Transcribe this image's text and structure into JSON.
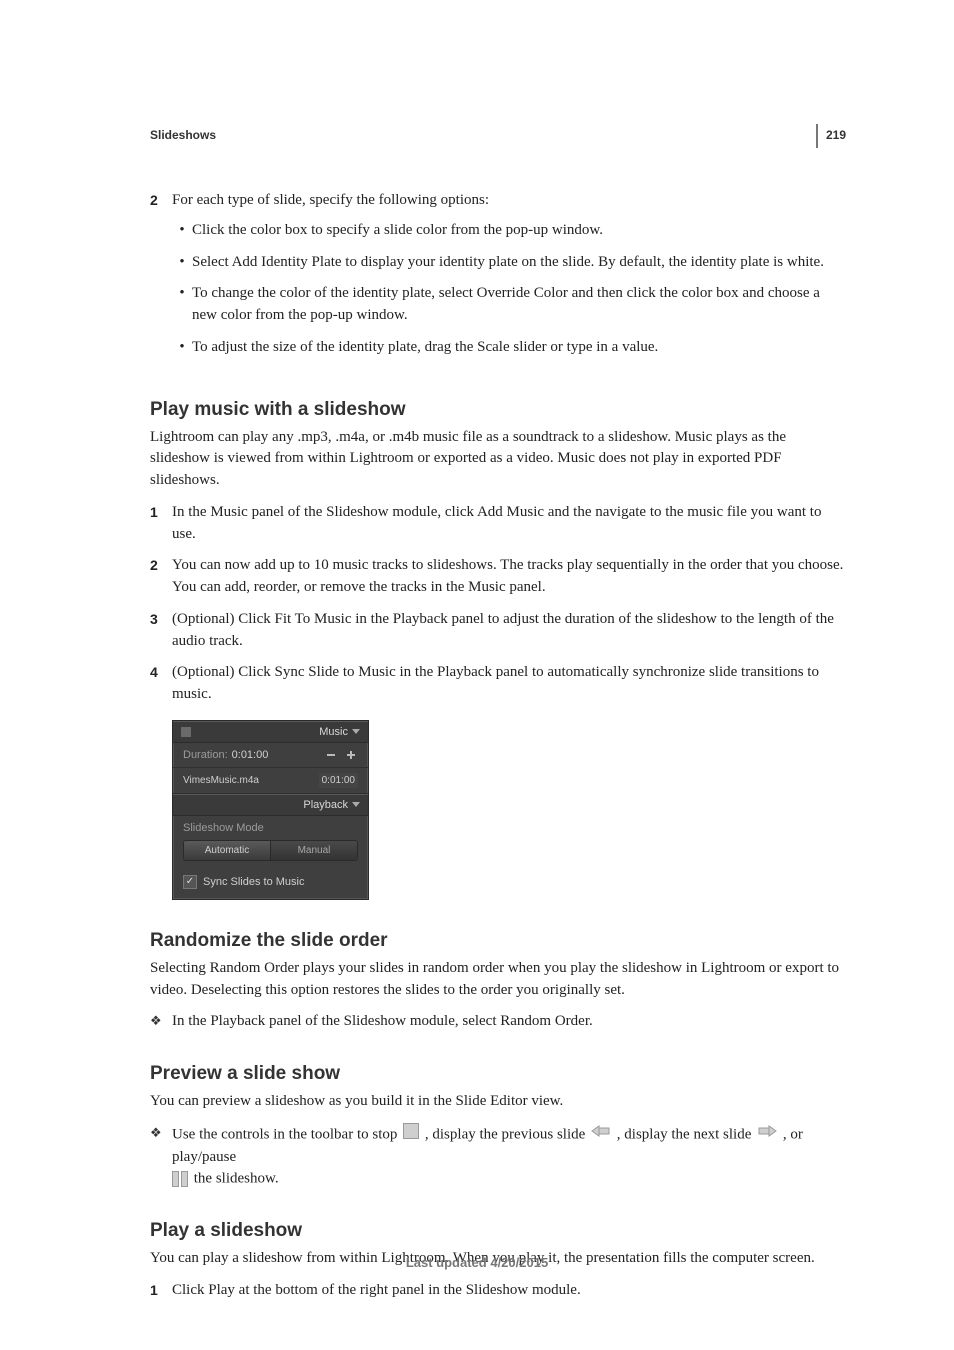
{
  "page_number": "219",
  "section_header": "Slideshows",
  "step2": {
    "num": "2",
    "lead": "For each type of slide, specify the following options:",
    "bullets": [
      "Click the color box to specify a slide color from the pop-up window.",
      "Select Add Identity Plate to display your identity plate on the slide. By default, the identity plate is white.",
      "To change the color of the identity plate, select Override Color and then click the color box and choose a new color from the pop-up window.",
      "To adjust the size of the identity plate, drag the Scale slider or type in a value."
    ]
  },
  "play_music": {
    "heading": "Play music with a slideshow",
    "intro": "Lightroom can play any .mp3, .m4a, or .m4b music file as a soundtrack to a slideshow. Music plays as the slideshow is viewed from within Lightroom or exported as a video. Music does not play in exported PDF slideshows.",
    "steps": [
      "In the Music panel of the Slideshow module, click Add Music and the navigate to the music file you want to use.",
      "You can now add up to 10 music tracks to slideshows. The tracks play sequentially in the order that you choose. You can add, reorder, or remove the tracks in the Music panel.",
      "(Optional) Click Fit To Music in the Playback panel to adjust the duration of the slideshow to the length of the audio track.",
      "(Optional) Click Sync Slide to Music in the Playback panel to automatically synchronize slide transitions to music."
    ],
    "step_nums": [
      "1",
      "2",
      "3",
      "4"
    ]
  },
  "panel": {
    "music_title": "Music",
    "duration_label": "Duration:",
    "duration_value": "0:01:00",
    "track_name": "VimesMusic.m4a",
    "track_duration": "0:01:00",
    "playback_title": "Playback",
    "slideshow_mode_label": "Slideshow Mode",
    "seg_auto": "Automatic",
    "seg_manual": "Manual",
    "sync_label": "Sync Slides to Music"
  },
  "randomize": {
    "heading": "Randomize the slide order",
    "intro": "Selecting Random Order plays your slides in random order when you play the slideshow in Lightroom or export to video. Deselecting this option restores the slides to the order you originally set.",
    "bullet": "In the Playback panel of the Slideshow module, select Random Order."
  },
  "preview": {
    "heading": "Preview a slide show",
    "intro": "You can preview a slideshow as you build it in the Slide Editor view.",
    "line_pre": "Use the controls in the toolbar to stop ",
    "line_mid1": ", display the previous slide ",
    "line_mid2": ", display the next slide ",
    "line_mid3": ", or play/pause ",
    "line_post": " the slideshow."
  },
  "play_slideshow": {
    "heading": "Play a slideshow",
    "intro": "You can play a slideshow from within Lightroom. When you play it, the presentation fills the computer screen.",
    "step_num": "1",
    "step_body": "Click Play at the bottom of the right panel in the Slideshow module."
  },
  "footer": "Last updated 4/20/2015"
}
